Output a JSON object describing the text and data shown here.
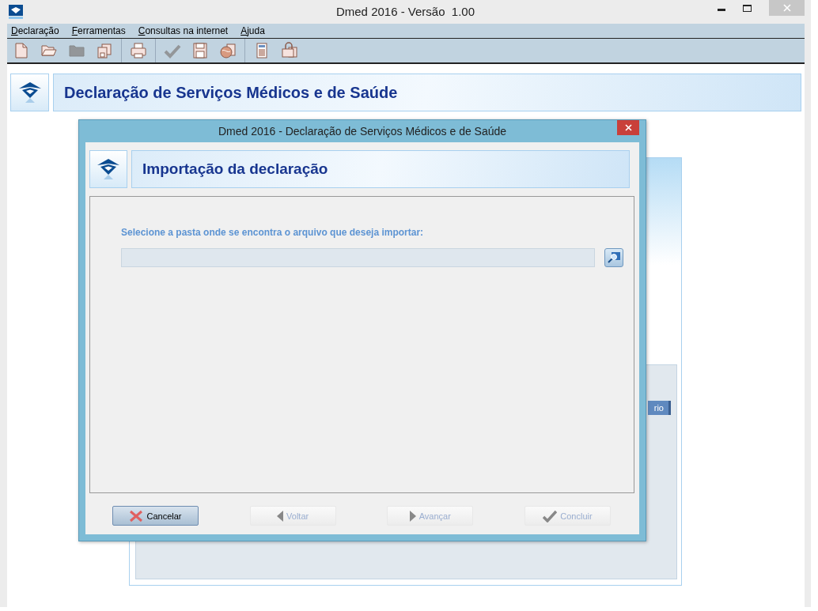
{
  "window": {
    "title": "Dmed 2016 - Versão  1.00"
  },
  "menu": [
    "Declaração",
    "Ferramentas",
    "Consultas na internet",
    "Ajuda"
  ],
  "toolbar": [
    {
      "kind": "new",
      "disabled": false
    },
    {
      "kind": "open",
      "disabled": false
    },
    {
      "kind": "folder",
      "disabled": true
    },
    {
      "kind": "copy",
      "disabled": false,
      "group_end": true
    },
    {
      "kind": "print",
      "disabled": false,
      "group_end": true
    },
    {
      "kind": "check",
      "disabled": true
    },
    {
      "kind": "save",
      "disabled": false
    },
    {
      "kind": "globe",
      "disabled": false,
      "group_end": true
    },
    {
      "kind": "calculator",
      "disabled": false
    },
    {
      "kind": "lock",
      "disabled": false
    }
  ],
  "banner": {
    "title": "Declaração de Serviços Médicos e de Saúde"
  },
  "background_panel": {
    "button_label": "rio"
  },
  "dialog": {
    "title": "Dmed 2016 - Declaração de Serviços Médicos e de Saúde",
    "header": "Importação da declaração",
    "prompt": "Selecione a pasta onde se encontra o arquivo que deseja importar:",
    "buttons": [
      {
        "kind": "cancel",
        "label": "Cancelar",
        "disabled": false
      },
      {
        "kind": "back",
        "label": "Voltar",
        "disabled": true
      },
      {
        "kind": "next",
        "label": "Avançar",
        "disabled": true
      },
      {
        "kind": "finish",
        "label": "Concluir",
        "disabled": true
      }
    ]
  }
}
